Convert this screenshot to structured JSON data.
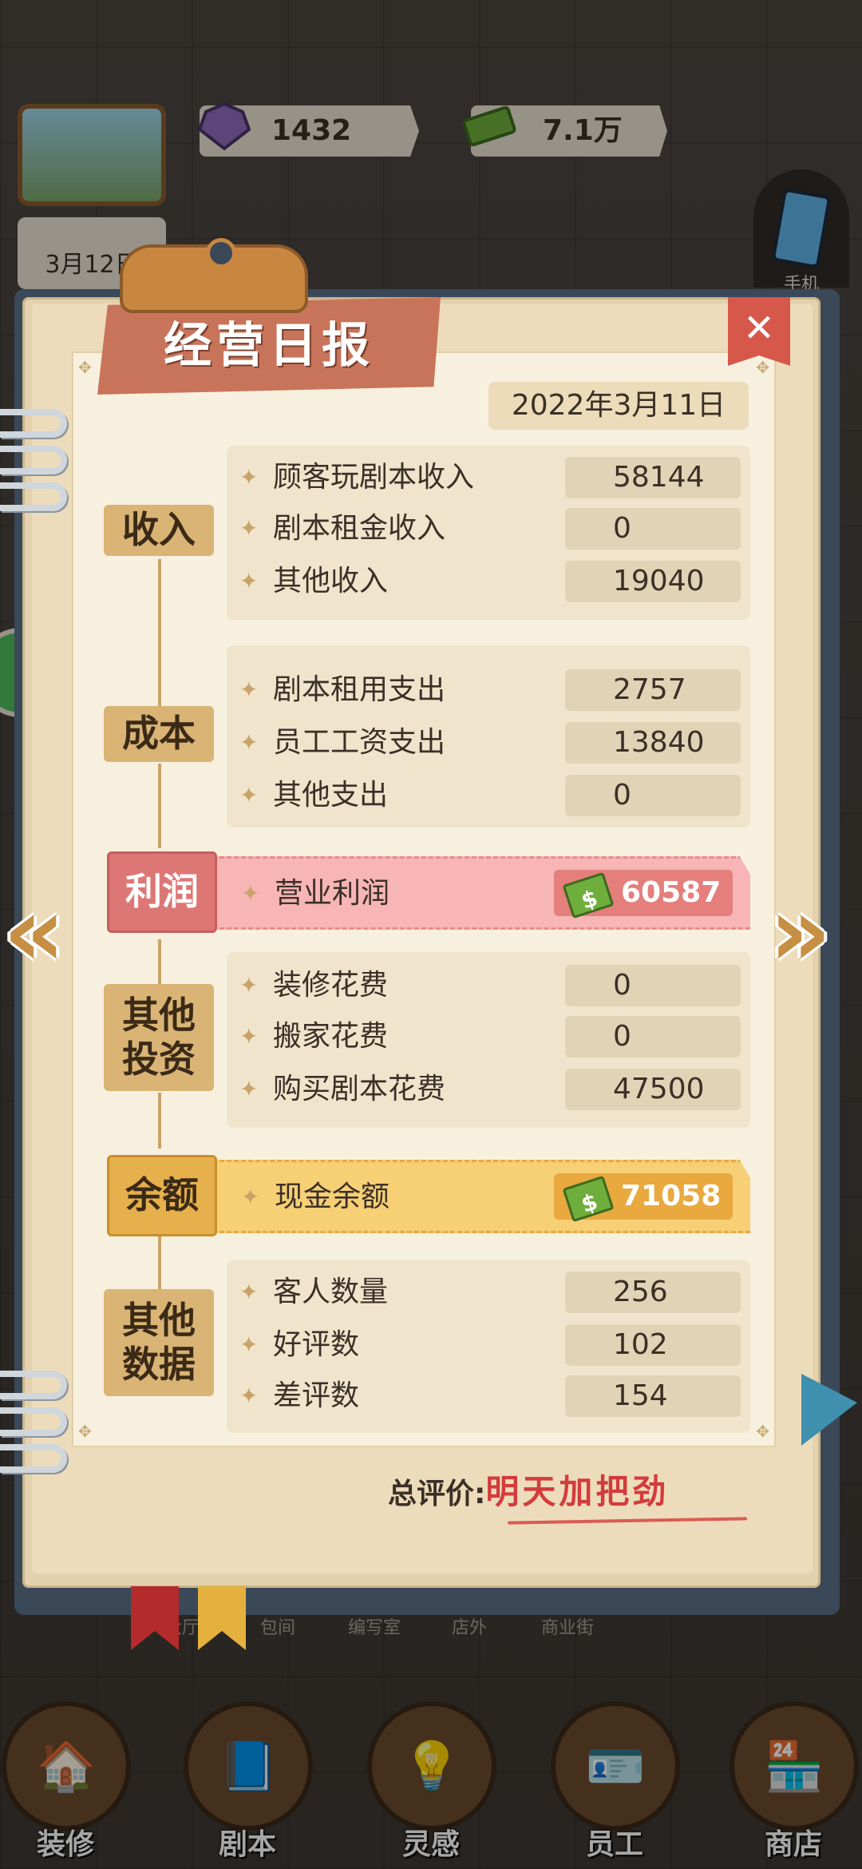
{
  "hud": {
    "gems": "1432",
    "cash": "7.1万",
    "date": "3月12日",
    "phone_label": "手机"
  },
  "bottom_nav": {
    "sub_tabs": [
      "大厅",
      "包间",
      "编写室",
      "店外",
      "商业街"
    ],
    "items": [
      {
        "label": "装修",
        "icon": "house-icon"
      },
      {
        "label": "剧本",
        "icon": "script-book-icon"
      },
      {
        "label": "灵感",
        "icon": "lightbulb-icon"
      },
      {
        "label": "员工",
        "icon": "staff-card-icon"
      },
      {
        "label": "商店",
        "icon": "shop-icon"
      }
    ]
  },
  "report": {
    "title": "经营日报",
    "date": "2022年3月11日",
    "close_label": "✕",
    "sections": {
      "income": {
        "label": "收入",
        "rows": [
          {
            "label": "顾客玩剧本收入",
            "value": "58144"
          },
          {
            "label": "剧本租金收入",
            "value": "0"
          },
          {
            "label": "其他收入",
            "value": "19040"
          }
        ]
      },
      "cost": {
        "label": "成本",
        "rows": [
          {
            "label": "剧本租用支出",
            "value": "2757"
          },
          {
            "label": "员工工资支出",
            "value": "13840"
          },
          {
            "label": "其他支出",
            "value": "0"
          }
        ]
      },
      "profit": {
        "label": "利润",
        "row_label": "营业利润",
        "value": "60587"
      },
      "invest": {
        "label_line1": "其他",
        "label_line2": "投资",
        "rows": [
          {
            "label": "装修花费",
            "value": "0"
          },
          {
            "label": "搬家花费",
            "value": "0"
          },
          {
            "label": "购买剧本花费",
            "value": "47500"
          }
        ]
      },
      "balance": {
        "label": "余额",
        "row_label": "现金余额",
        "value": "71058"
      },
      "other": {
        "label_line1": "其他",
        "label_line2": "数据",
        "rows": [
          {
            "label": "客人数量",
            "value": "256"
          },
          {
            "label": "好评数",
            "value": "102"
          },
          {
            "label": "差评数",
            "value": "154"
          }
        ]
      }
    },
    "summary_label": "总评价:",
    "summary_value": "明天加把劲"
  },
  "colors": {
    "profit_ribbon": "#f7b5b5",
    "balance_ribbon": "#f7cf75",
    "title_banner": "#c8745a",
    "close_button": "#d6584a",
    "summary_text": "#d23c3c"
  }
}
